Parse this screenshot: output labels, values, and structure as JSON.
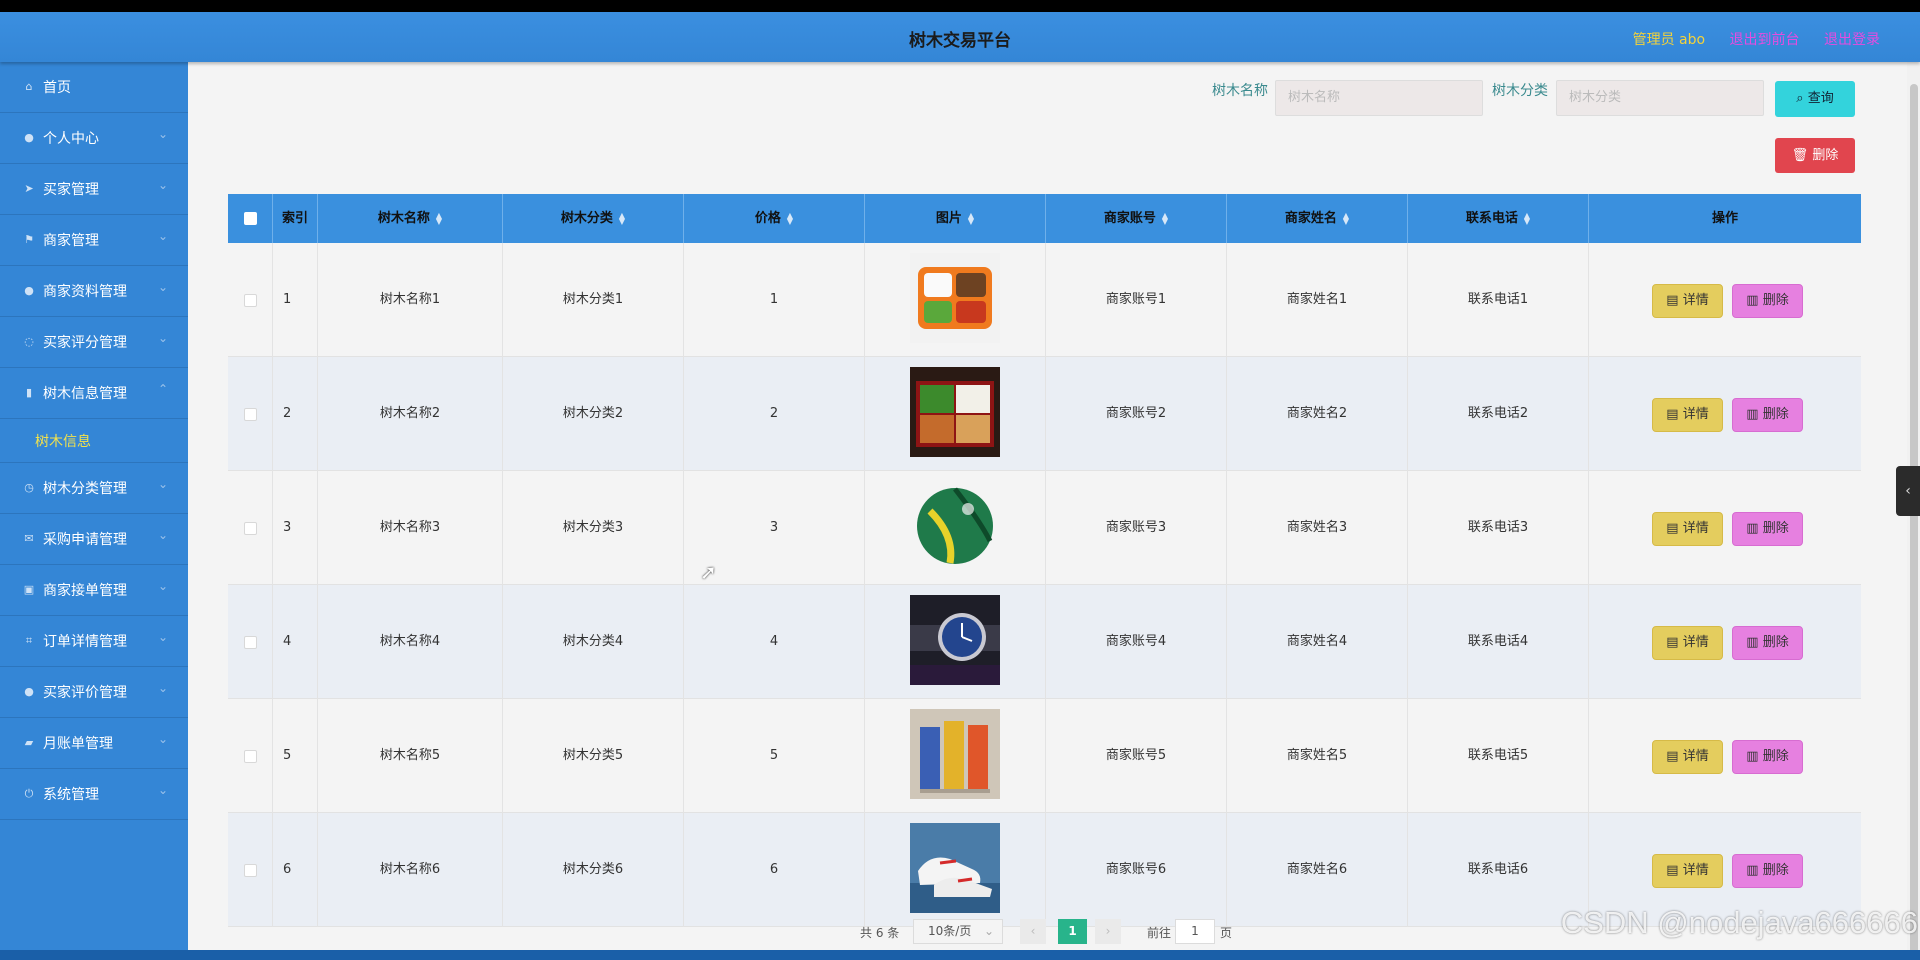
{
  "header": {
    "title": "树木交易平台",
    "admin_label": "管理员 abo",
    "link_front": "退出到前台",
    "link_logout": "退出登录"
  },
  "sidebar": {
    "items": [
      {
        "label": "首页",
        "icon": "home-icon"
      },
      {
        "label": "个人中心",
        "icon": "user-icon"
      },
      {
        "label": "买家管理",
        "icon": "send-icon"
      },
      {
        "label": "商家管理",
        "icon": "flag-icon"
      },
      {
        "label": "商家资料管理",
        "icon": "user-icon"
      },
      {
        "label": "买家评分管理",
        "icon": "bell-icon"
      },
      {
        "label": "树木信息管理",
        "icon": "chart-icon",
        "expanded": true,
        "sub": "树木信息"
      },
      {
        "label": "树木分类管理",
        "icon": "clock-icon"
      },
      {
        "label": "采购申请管理",
        "icon": "mail-icon"
      },
      {
        "label": "商家接单管理",
        "icon": "bag-icon"
      },
      {
        "label": "订单详情管理",
        "icon": "crop-icon"
      },
      {
        "label": "买家评价管理",
        "icon": "location-icon"
      },
      {
        "label": "月账单管理",
        "icon": "thumb-icon"
      },
      {
        "label": "系统管理",
        "icon": "power-icon"
      }
    ]
  },
  "search": {
    "name_label": "树木名称",
    "name_placeholder": "树木名称",
    "category_label": "树木分类",
    "category_placeholder": "树木分类",
    "query_button": "查询",
    "delete_button": "删除"
  },
  "table": {
    "headers": {
      "index": "索引",
      "name": "树木名称",
      "category": "树木分类",
      "price": "价格",
      "image": "图片",
      "account": "商家账号",
      "merchant": "商家姓名",
      "phone": "联系电话",
      "actions": "操作"
    },
    "rows": [
      {
        "index": "1",
        "name": "树木名称1",
        "category": "树木分类1",
        "price": "1",
        "account": "商家账号1",
        "merchant": "商家姓名1",
        "phone": "联系电话1"
      },
      {
        "index": "2",
        "name": "树木名称2",
        "category": "树木分类2",
        "price": "2",
        "account": "商家账号2",
        "merchant": "商家姓名2",
        "phone": "联系电话2"
      },
      {
        "index": "3",
        "name": "树木名称3",
        "category": "树木分类3",
        "price": "3",
        "account": "商家账号3",
        "merchant": "商家姓名3",
        "phone": "联系电话3"
      },
      {
        "index": "4",
        "name": "树木名称4",
        "category": "树木分类4",
        "price": "4",
        "account": "商家账号4",
        "merchant": "商家姓名4",
        "phone": "联系电话4"
      },
      {
        "index": "5",
        "name": "树木名称5",
        "category": "树木分类5",
        "price": "5",
        "account": "商家账号5",
        "merchant": "商家姓名5",
        "phone": "联系电话5"
      },
      {
        "index": "6",
        "name": "树木名称6",
        "category": "树木分类6",
        "price": "6",
        "account": "商家账号6",
        "merchant": "商家姓名6",
        "phone": "联系电话6"
      }
    ],
    "detail_label": "详情",
    "delete_label": "删除"
  },
  "pager": {
    "total": "共 6 条",
    "page_size": "10条/页",
    "current": "1",
    "goto": "前往",
    "goto_value": "1",
    "page_unit": "页"
  },
  "watermark": "CSDN @nodejava666666",
  "colors": {
    "header": "#3486d6",
    "sidebar": "#3486d6",
    "query": "#33d3dc",
    "delete": "#e1454e",
    "detail": "#e4cd5e",
    "row_delete": "#e680e0",
    "pager_active": "#28b48b"
  }
}
